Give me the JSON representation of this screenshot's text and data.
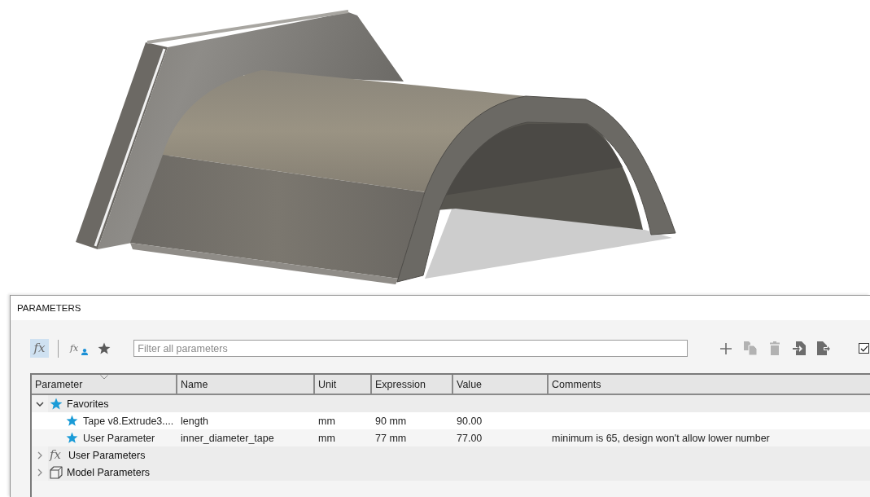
{
  "panel": {
    "title": "PARAMETERS",
    "toolbar": {
      "filters": [
        {
          "kind": "all",
          "symbol": "fx",
          "selected": true
        },
        {
          "kind": "user",
          "symbol": "fx",
          "selected": false
        },
        {
          "kind": "favorites",
          "selected": false
        }
      ],
      "search": {
        "placeholder": "Filter all parameters"
      },
      "actions": [
        {
          "kind": "add",
          "disabled": false
        },
        {
          "kind": "copy",
          "disabled": true
        },
        {
          "kind": "delete",
          "disabled": true
        },
        {
          "kind": "import",
          "disabled": false
        },
        {
          "kind": "export",
          "disabled": false
        }
      ],
      "checkbox": {
        "checked": true
      }
    },
    "table": {
      "columns": [
        {
          "label": "Parameter",
          "sorted": true
        },
        {
          "label": "Name",
          "sorted": false
        },
        {
          "label": "Unit",
          "sorted": false
        },
        {
          "label": "Expression",
          "sorted": false
        },
        {
          "label": "Value",
          "sorted": false
        },
        {
          "label": "Comments",
          "sorted": false
        }
      ],
      "rows": [
        {
          "kind": "favorites",
          "label": "Favorites",
          "expanded": true,
          "children": [
            {
              "favorite": true,
              "parameter": "Tape v8.Extrude3....",
              "name": "length",
              "unit": "mm",
              "expression": "90 mm",
              "value": "90.00"
            },
            {
              "favorite": true,
              "parameter": "User Parameter",
              "name": "inner_diameter_tape",
              "unit": "mm",
              "expression": "77 mm",
              "value": "77.00",
              "comments": "minimum is 65, design won't allow lower number"
            }
          ]
        },
        {
          "kind": "user",
          "symbol": "fx",
          "label": "User Parameters",
          "expanded": false
        },
        {
          "kind": "model",
          "label": "Model Parameters",
          "expanded": false
        }
      ]
    }
  }
}
